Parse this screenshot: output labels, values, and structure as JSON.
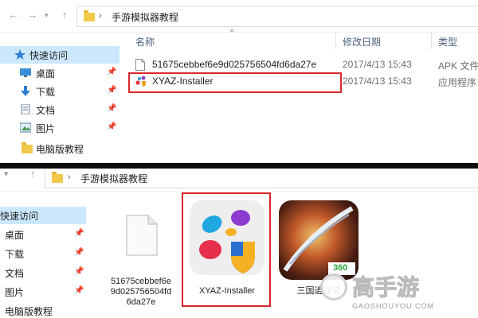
{
  "top": {
    "address": {
      "breadcrumb": "手游模拟器教程"
    },
    "sidebar": {
      "items": [
        {
          "label": "快速访问"
        },
        {
          "label": "桌面"
        },
        {
          "label": "下载"
        },
        {
          "label": "文档"
        },
        {
          "label": "图片"
        },
        {
          "label": "电脑版教程"
        }
      ]
    },
    "columns": {
      "name": "名称",
      "date": "修改日期",
      "type": "类型"
    },
    "files": [
      {
        "name": "51675cebbef6e9d025756504fd6da27e",
        "date": "2017/4/13 15:43",
        "type": "APK 文件"
      },
      {
        "name": "XYAZ-Installer",
        "date": "2017/4/13 15:43",
        "type": "应用程序"
      }
    ]
  },
  "bottom": {
    "address": {
      "breadcrumb": "手游模拟器教程"
    },
    "sidebar": {
      "items": [
        {
          "label": "快速访问"
        },
        {
          "label": "桌面"
        },
        {
          "label": "下载"
        },
        {
          "label": "文档"
        },
        {
          "label": "图片"
        },
        {
          "label": "电脑版教程"
        }
      ]
    },
    "tiles": [
      {
        "label_line1": "51675cebbef6e",
        "label_line2": "9d025756504fd",
        "label_line3": "6da27e"
      },
      {
        "label": "XYAZ-Installer"
      },
      {
        "label": "三国逍遥记",
        "badge": "360"
      }
    ]
  },
  "watermark": {
    "brand": "高手游",
    "domain": "GAOSHOUYOU.COM"
  },
  "colors": {
    "highlight_red": "#d9272b",
    "sidebar_selected": "#cce8ff",
    "folder_yellow": "#f2c84b"
  }
}
